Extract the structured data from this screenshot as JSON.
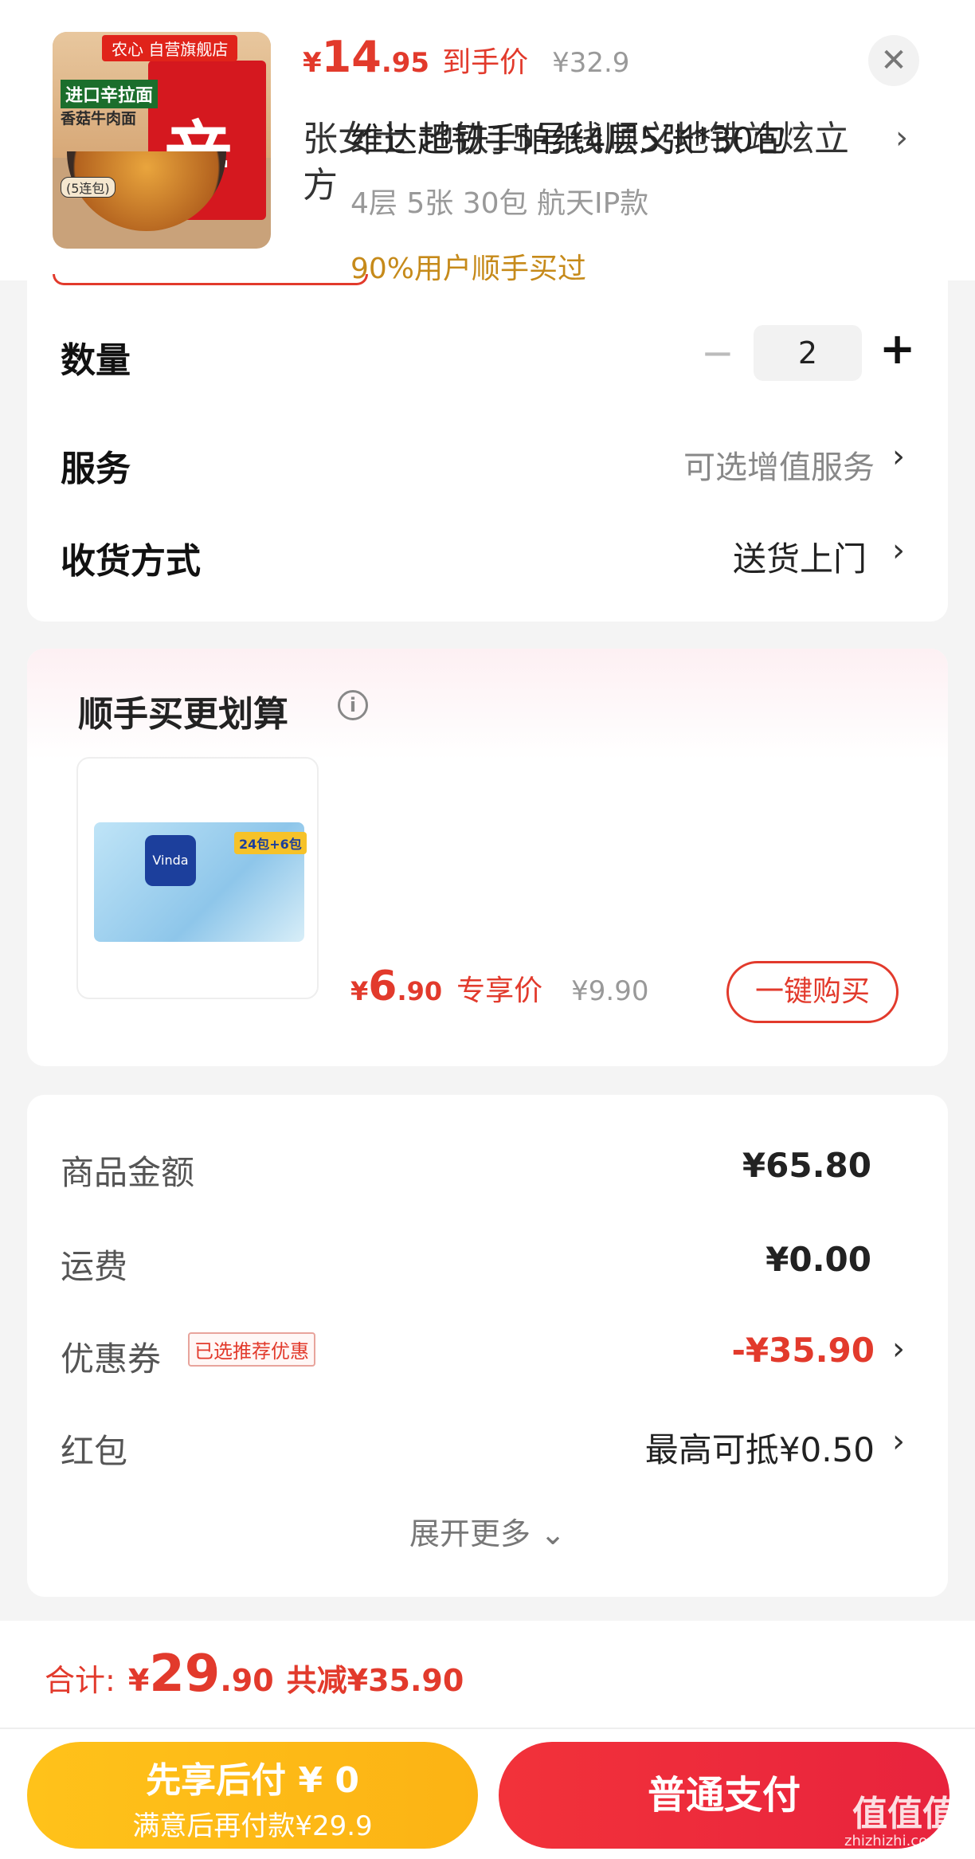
{
  "header": {
    "thumb": {
      "badge": "农心 自营旗舰店",
      "label1": "进口辛拉面",
      "label2": "香菇牛肉面",
      "label3": "(5连包)",
      "char": "辛"
    },
    "price_currency": "¥",
    "price_int": "14",
    "price_dec": ".95",
    "price_tag": "到手价",
    "price_orig": "¥32.9",
    "close": "✕",
    "address": "张女士  地铁15号线顺义地铁站炫立方",
    "address_arrow": "›"
  },
  "options": {
    "quantity_label": "数量",
    "quantity_value": "2",
    "minus": "−",
    "plus": "+",
    "service_label": "服务",
    "service_value": "可选增值服务",
    "delivery_label": "收货方式",
    "delivery_value": "送货上门",
    "arrow": "›"
  },
  "upsell": {
    "title": "顺手买更划算",
    "info": "i",
    "image": {
      "logo": "Vinda",
      "tag": "24包+6包"
    },
    "name": "维达超韧手帕纸4层5张*30包",
    "spec": "4层 5张 30包 航天IP款",
    "social": "90%用户顺手买过",
    "price_currency": "¥",
    "price_int": "6",
    "price_dec": ".90",
    "price_tag": "专享价",
    "price_orig": "¥9.90",
    "buy_button": "一键购买"
  },
  "fees": {
    "goods_label": "商品金额",
    "goods_value": "¥65.80",
    "shipping_label": "运费",
    "shipping_value": "¥0.00",
    "coupon_label": "优惠券",
    "coupon_badge": "已选推荐优惠",
    "coupon_value": "-¥35.90",
    "redpacket_label": "红包",
    "redpacket_value": "最高可抵¥0.50",
    "expand": "展开更多 ⌄",
    "arrow": "›"
  },
  "total": {
    "label": "合计:",
    "currency": "¥",
    "int": "29",
    "dec": ".90",
    "saving": "共减¥35.90"
  },
  "actions": {
    "pay_later_line1": "先享后付 ¥ 0",
    "pay_later_line2": "满意后再付款¥29.9",
    "pay_normal": "普通支付"
  },
  "watermark": {
    "text": "值值值",
    "sub": "zhizhizhi.com"
  },
  "colors": {
    "accent": "#e23a2c",
    "pay_later": "#fcb314",
    "pay_normal": "#e8233d"
  }
}
